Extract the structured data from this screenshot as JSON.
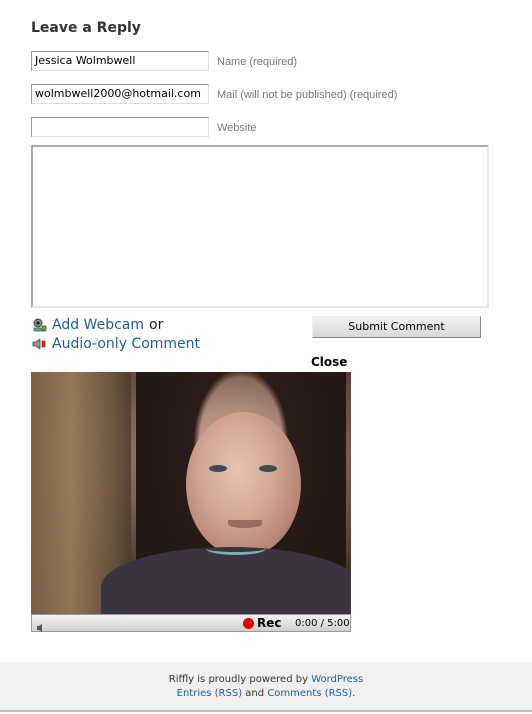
{
  "form": {
    "heading": "Leave a Reply",
    "name_value": "Jessica Wolmbwell",
    "name_label": "Name (required)",
    "mail_value": "wolmbwell2000@hotmail.com",
    "mail_label": "Mail (will not be published) (required)",
    "website_value": "",
    "website_label": "Website",
    "comment_value": ""
  },
  "riffly": {
    "webcam_link": "Add Webcam",
    "or_text": "or",
    "audio_link": "Audio-only Comment",
    "submit_label": "Submit Comment",
    "close_label": "Close",
    "icons": [
      "webcam-icon",
      "speaker-icon"
    ]
  },
  "player": {
    "rec_label": "Rec",
    "time": "0:00 / 5:00",
    "rec_color": "#e00000"
  },
  "footer": {
    "powered_prefix": "Riffly is proudly powered by",
    "wordpress_link": "WordPress",
    "entries_link": "Entries (RSS)",
    "and_text": "and",
    "comments_link": "Comments (RSS)",
    "period": ".",
    "link_color": "#1e5f9a"
  }
}
